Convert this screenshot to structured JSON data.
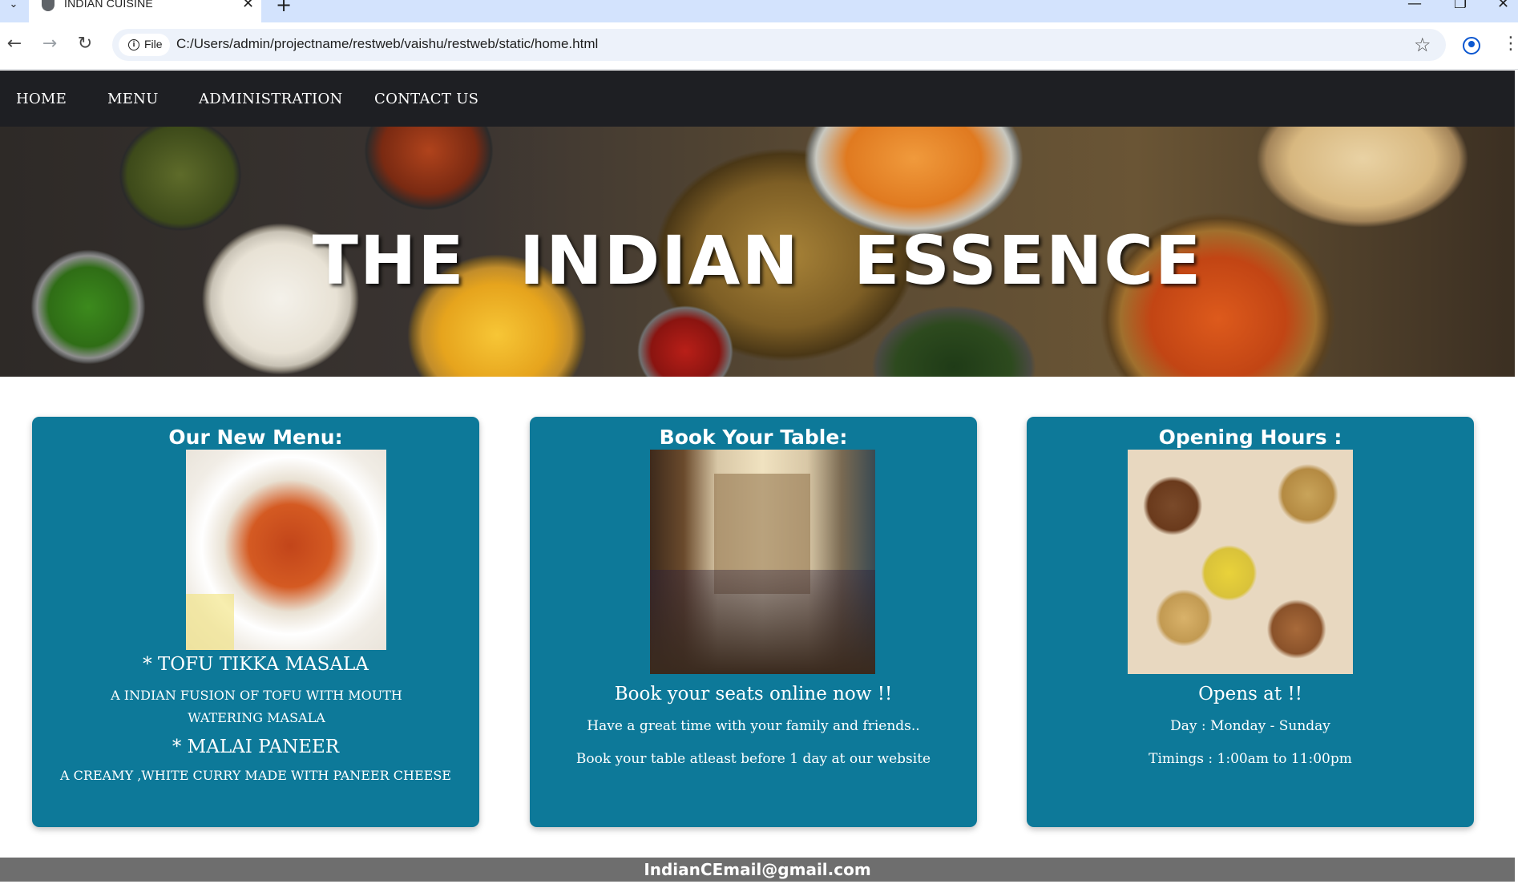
{
  "browser": {
    "tab_title": "INDIAN CUISINE",
    "site_info_label": "File",
    "url": "C:/Users/admin/projectname/restweb/vaishu/restweb/static/home.html"
  },
  "nav": {
    "items": [
      {
        "label": "HOME"
      },
      {
        "label": "MENU"
      },
      {
        "label": "ADMINISTRATION"
      },
      {
        "label": "CONTACT US"
      }
    ]
  },
  "hero": {
    "title": "THE INDIAN ESSENCE"
  },
  "cards": {
    "menu": {
      "heading": "Our New Menu:",
      "items": [
        {
          "name": "* TOFU TIKKA MASALA",
          "description": "A INDIAN FUSION OF TOFU WITH MOUTH WATERING MASALA"
        },
        {
          "name": "* MALAI PANEER",
          "description": "A CREAMY ,WHITE CURRY MADE WITH PANEER CHEESE"
        }
      ]
    },
    "booking": {
      "heading": "Book Your Table:",
      "subheading": "Book your seats online now !!",
      "line1": "Have a great time with your family and friends..",
      "line2": "Book your table atleast before 1 day at our website"
    },
    "hours": {
      "heading": "Opening Hours :",
      "subheading": "Opens at !!",
      "line1": "Day : Monday - Sunday",
      "line2": "Timings : 1:00am to 11:00pm"
    }
  },
  "footer": {
    "email": "IndianCEmail@gmail.com"
  },
  "colors": {
    "navbar_bg": "#1e1f23",
    "card_bg": "#0d7999",
    "footer_bg": "#6e6e6e"
  }
}
